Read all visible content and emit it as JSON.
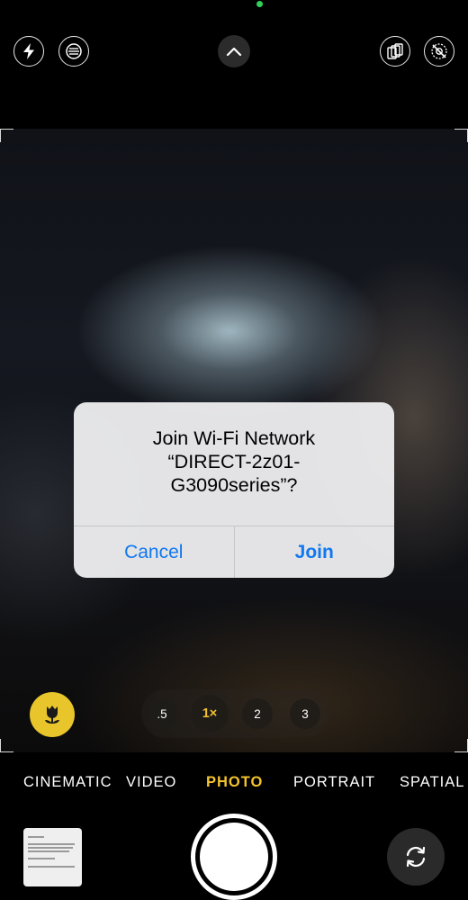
{
  "alert": {
    "title_line1": "Join Wi-Fi Network",
    "title_line2": "“DIRECT-2z01-",
    "title_line3": "G3090series”?",
    "cancel_label": "Cancel",
    "join_label": "Join"
  },
  "zoom": {
    "options": [
      ".5",
      "1×",
      "2",
      "3"
    ],
    "selected": "1×"
  },
  "modes": {
    "items": [
      "CINEMATIC",
      "VIDEO",
      "PHOTO",
      "PORTRAIT",
      "SPATIAL"
    ],
    "selected": "PHOTO"
  },
  "colors": {
    "accent_yellow": "#f2c32d",
    "macro_yellow": "#e8c52b",
    "alert_button_blue": "#1078f0",
    "status_dot_green": "#2fd158"
  },
  "icons": {
    "flash": "flash-icon",
    "live_photo": "live-photo-icon",
    "controls_toggle": "chevron-up-icon",
    "styles": "photographic-styles-icon",
    "live_off": "live-off-icon",
    "macro": "macro-tulip-icon",
    "flip": "camera-flip-icon"
  }
}
